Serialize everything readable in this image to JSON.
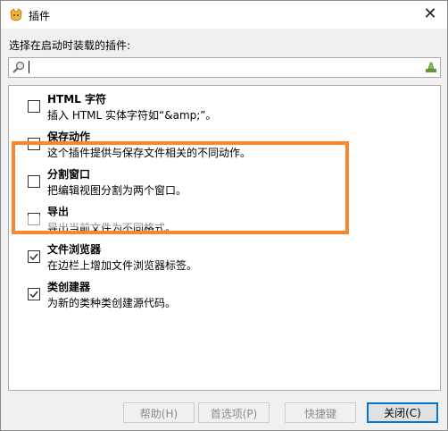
{
  "window": {
    "title": "插件",
    "close_glyph": "✕"
  },
  "prompt": "选择在启动时装载的插件:",
  "search": {
    "value": "",
    "placeholder": ""
  },
  "plugins": [
    {
      "title": "HTML 字符",
      "description": "插入 HTML 实体字符如“&amp;”。",
      "checked": false
    },
    {
      "title": "保存动作",
      "description": "这个插件提供与保存文件相关的不同动作。",
      "checked": false
    },
    {
      "title": "分割窗口",
      "description": "把编辑视图分割为两个窗口。",
      "checked": false
    },
    {
      "title": "导出",
      "description": "导出当前文件为不同格式。",
      "checked": false
    },
    {
      "title": "文件浏览器",
      "description": "在边栏上增加文件浏览器标签。",
      "checked": true
    },
    {
      "title": "类创建器",
      "description": "为新的类种类创建源代码。",
      "checked": true
    }
  ],
  "buttons": {
    "help": "帮助(H)",
    "preferences": "首选项(P)",
    "shortcuts": "快捷键",
    "close": "关闭(C)"
  },
  "colors": {
    "highlight": "#f7882f",
    "focus": "#0078d7"
  }
}
